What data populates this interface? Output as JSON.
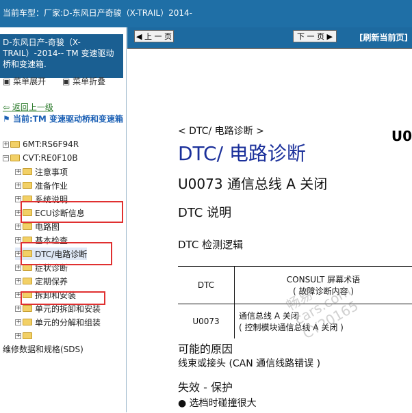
{
  "header": {
    "label": "当前车型：",
    "text": "厂家:D-东风日产奇骏（X-TRAIL）2014-"
  },
  "sidebar": {
    "title": "D-东风日产-奇骏（X-TRAIL）-2014-- TM 变速驱动桥和变速箱.",
    "expand": "菜单展开",
    "collapse": "菜单折叠",
    "back": "返回上一级",
    "current": "当前:TM 变速驱动桥和变速箱",
    "items": [
      "6MT:RS6F94R",
      "CVT:RE0F10B",
      "注意事项",
      "准备作业",
      "系统说明",
      "ECU诊断信息",
      "电路图",
      "基本检查",
      "DTC/电路诊断",
      "症状诊断",
      "定期保养",
      "拆卸和安装",
      "单元的拆卸和安装",
      "单元的分解和组装"
    ],
    "sds": "维修数据和规格(SDS)"
  },
  "nav": {
    "prev": "上 一 页",
    "next": "下 一 页",
    "refresh": "[刷新当前页]"
  },
  "doc": {
    "code_partial": "U0",
    "crumb": "< DTC/ 电路诊断 >",
    "title": "DTC/ 电路诊断",
    "subtitle": "U0073 通信总线 A 关闭",
    "section": "DTC 说明",
    "logic": "DTC 检测逻辑",
    "table": {
      "h1": "DTC",
      "h2a": "CONSULT 屏幕术语",
      "h2b": "( 故障诊断内容 )",
      "code": "U0073",
      "desc1": "通信总线 A 关闭",
      "desc2": "( 控制模块通信总线 A 关闭 )"
    },
    "cause_title": "可能的原因",
    "cause": "线束或接头 (CAN 通信线路错误 )",
    "fail_title": "失效 - 保护",
    "bullet": "选档时碰撞很大"
  },
  "watermark": [
    "畅易",
    "cars.com",
    "CY20165"
  ]
}
